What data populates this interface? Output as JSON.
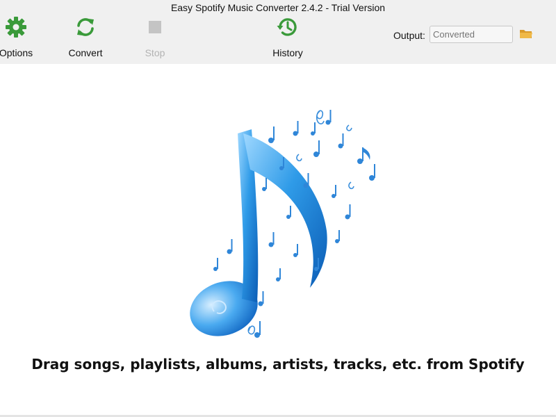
{
  "window": {
    "title": "Easy Spotify Music Converter 2.4.2 - Trial Version"
  },
  "toolbar": {
    "options": {
      "label": "Options",
      "icon": "gear-icon",
      "color": "#3a9a3a"
    },
    "convert": {
      "label": "Convert",
      "icon": "refresh-icon",
      "color": "#3a9a3a"
    },
    "stop": {
      "label": "Stop",
      "icon": "stop-icon",
      "color": "#c4c4c4",
      "enabled": false
    },
    "history": {
      "label": "History",
      "icon": "history-icon",
      "color": "#3a9a3a"
    }
  },
  "output": {
    "label": "Output:",
    "placeholder": "Converted",
    "value": "",
    "folder_icon": "folder-icon",
    "folder_color": "#e0a030"
  },
  "drop_area": {
    "image": "music-note-art",
    "hint": "Drag songs, playlists, albums, artists, tracks, etc. from Spotify"
  }
}
